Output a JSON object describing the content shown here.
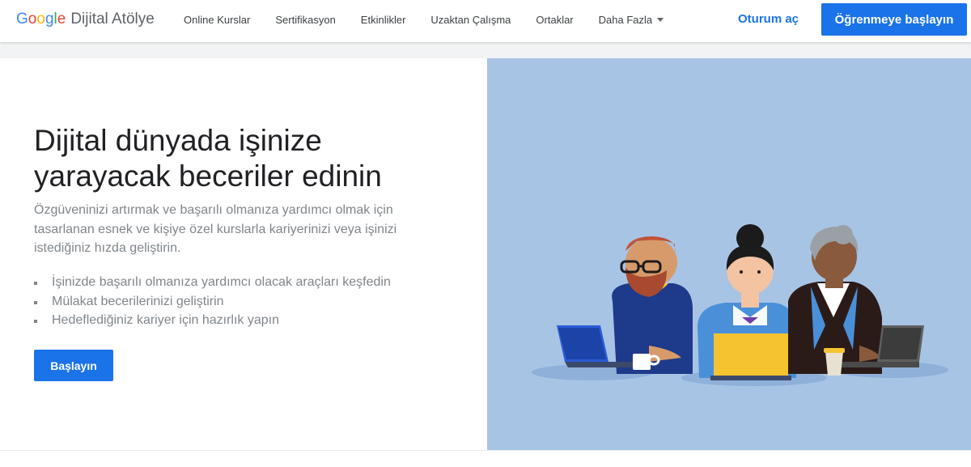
{
  "header": {
    "logo": {
      "google_letters": [
        {
          "ch": "G",
          "color": "#4285F4"
        },
        {
          "ch": "o",
          "color": "#EA4335"
        },
        {
          "ch": "o",
          "color": "#FBBC05"
        },
        {
          "ch": "g",
          "color": "#4285F4"
        },
        {
          "ch": "l",
          "color": "#34A853"
        },
        {
          "ch": "e",
          "color": "#EA4335"
        }
      ],
      "product": "Dijital Atölye"
    },
    "nav": [
      {
        "label": "Online Kurslar"
      },
      {
        "label": "Sertifikasyon"
      },
      {
        "label": "Etkinlikler"
      },
      {
        "label": "Uzaktan Çalışma"
      },
      {
        "label": "Ortaklar"
      },
      {
        "label": "Daha Fazla"
      }
    ],
    "signin_label": "Oturum aç",
    "cta_label": "Öğrenmeye başlayın"
  },
  "hero": {
    "title_line1": "Dijital dünyada işinize",
    "title_line2": "yarayacak beceriler edinin",
    "subtitle": "Özgüveninizi artırmak ve başarılı olmanıza yardımcı olmak için tasarlanan esnek ve kişiye özel kurslarla kariyerinizi veya işinizi istediğiniz hızda geliştirin.",
    "bullets": [
      "İşinizde başarılı olmanıza yardımcı olacak araçları keşfedin",
      "Mülakat becerilerinizi geliştirin",
      "Hedeflediğiniz kariyer için hazırlık yapın"
    ],
    "button_label": "Başlayın"
  },
  "colors": {
    "brand_blue": "#1a73e8",
    "illustration_bg": "#a7c4e5"
  },
  "icons": {
    "nav_more": "caret-down-icon"
  }
}
